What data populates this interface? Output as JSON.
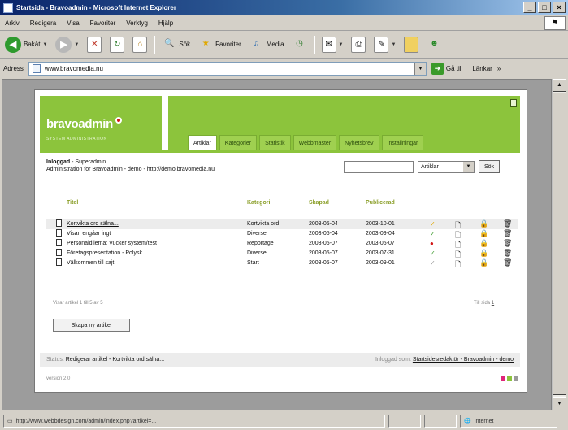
{
  "window": {
    "title": "Startsida - Bravoadmin - Microsoft Internet Explorer"
  },
  "menu": [
    "Arkiv",
    "Redigera",
    "Visa",
    "Favoriter",
    "Verktyg",
    "Hjälp"
  ],
  "toolbar": {
    "back": "Bakåt",
    "search": "Sök",
    "favorites": "Favoriter",
    "media": "Media"
  },
  "address": {
    "label": "Adress",
    "url": "www.bravomedia.nu",
    "go": "Gå till",
    "links": "Länkar"
  },
  "admin": {
    "logo": "bravoadmin",
    "logo_sub": "SYSTEM ADMINISTRATION",
    "tabs": [
      "Artiklar",
      "Kategorier",
      "Statistik",
      "Webbmaster",
      "Nyhetsbrev",
      "Inställningar"
    ],
    "user_label": "Inloggad",
    "user_name": "Superadmin",
    "admin_text": "Administration för Bravoadmin - demo -",
    "admin_link": "http://demo.bravomedia.nu",
    "search": {
      "value": "",
      "option": "Artiklar",
      "button": "Sök"
    },
    "columns": [
      "Titel",
      "Kategori",
      "Skapad",
      "Publicerad"
    ],
    "rows": [
      {
        "title": "Kortvikta ord sälna...",
        "category": "Kortvikta ord",
        "created": "2003-05-04",
        "published": "2003-10-01",
        "status": "✓"
      },
      {
        "title": "Visan engåar ingt",
        "category": "Diverse",
        "created": "2003-05-04",
        "published": "2003-09-04",
        "status": "✓"
      },
      {
        "title": "Personaldilema: Vucker system/test",
        "category": "Reportage",
        "created": "2003-05-07",
        "published": "2003-05-07",
        "status": "●"
      },
      {
        "title": "Företagspresentation - Polysk",
        "category": "Diverse",
        "created": "2003-05-07",
        "published": "2003-07-31",
        "status": "✓"
      },
      {
        "title": "Välkommen till sajt",
        "category": "Start",
        "created": "2003-05-07",
        "published": "2003-09-01",
        "status": "✓"
      }
    ],
    "pager_left": "Visar artikel 1 till 5 av 5",
    "pager_right": "Till sida",
    "pager_page": "1",
    "new_button": "Skapa ny artikel",
    "status_label": "Status:",
    "status_text": "Redigerar artikel - Kortvikta ord sälna...",
    "logged_label": "Inloggad som:",
    "logged_links": "Startsidesredaktör - Bravoadmin - demo",
    "version": "version 2.0",
    "colors": [
      "#e0257a",
      "#8cc43c",
      "#9a9a9a"
    ]
  },
  "statusbar": {
    "url": "http://www.webbdesign.com/admin/index.php?artikel=...",
    "zone": "Internet"
  }
}
